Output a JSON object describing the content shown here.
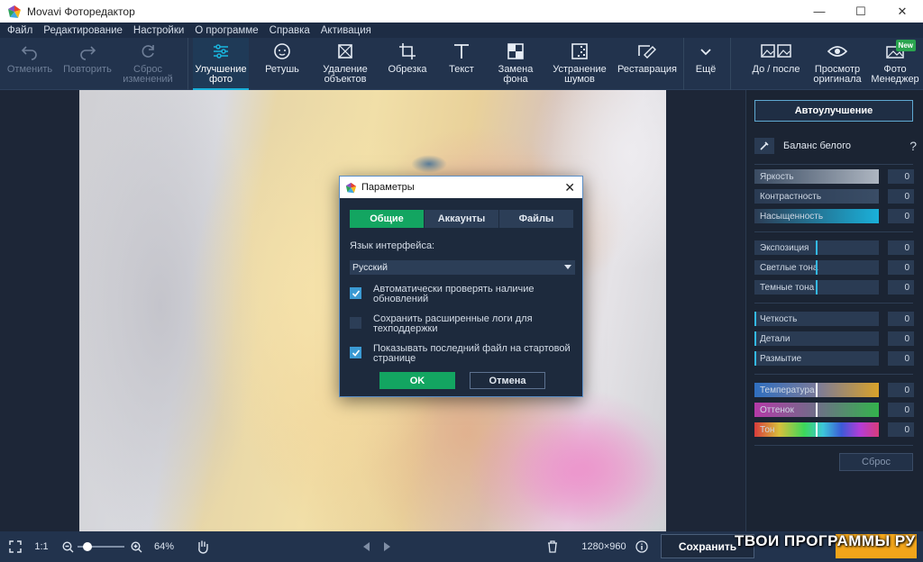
{
  "window": {
    "title": "Movavi Фоторедактор"
  },
  "menu": [
    "Файл",
    "Редактирование",
    "Настройки",
    "О программе",
    "Справка",
    "Активация"
  ],
  "toolbar": {
    "undo": "Отменить",
    "redo": "Повторить",
    "reset_line1": "Сброс",
    "reset_line2": "изменений",
    "enhance_line1": "Улучшение",
    "enhance_line2": "фото",
    "retouch": "Ретушь",
    "remove_line1": "Удаление",
    "remove_line2": "объектов",
    "crop": "Обрезка",
    "text": "Текст",
    "bg_line1": "Замена",
    "bg_line2": "фона",
    "noise_line1": "Устранение",
    "noise_line2": "шумов",
    "restore": "Реставрация",
    "more": "Ещё",
    "before_after": "До / после",
    "original_line1": "Просмотр",
    "original_line2": "оригинала",
    "manager_line1": "Фото",
    "manager_line2": "Менеджер",
    "new_badge": "New"
  },
  "panel": {
    "auto_button": "Автоулучшение",
    "white_balance": "Баланс белого",
    "help": "?",
    "sliders": [
      {
        "label": "Яркость",
        "value": "0"
      },
      {
        "label": "Контрастность",
        "value": "0"
      },
      {
        "label": "Насыщенность",
        "value": "0"
      },
      {
        "label": "Экспозиция",
        "value": "0"
      },
      {
        "label": "Светлые тона",
        "value": "0"
      },
      {
        "label": "Темные тона",
        "value": "0"
      },
      {
        "label": "Четкость",
        "value": "0"
      },
      {
        "label": "Детали",
        "value": "0"
      },
      {
        "label": "Размытие",
        "value": "0"
      },
      {
        "label": "Температура",
        "value": "0"
      },
      {
        "label": "Оттенок",
        "value": "0"
      },
      {
        "label": "Тон",
        "value": "0"
      }
    ],
    "reset_button": "Сброс"
  },
  "status": {
    "ratio": "1:1",
    "zoom": "64%",
    "zoom_level": 0.14,
    "dimensions": "1280×960",
    "save": "Сохранить",
    "watermark": "ТВОИ ПРОГРАММЫ РУ"
  },
  "dialog": {
    "title": "Параметры",
    "tabs": [
      "Общие",
      "Аккаунты",
      "Файлы"
    ],
    "lang_label": "Язык интерфейса:",
    "lang_value": "Русский",
    "options": [
      {
        "label": "Автоматически проверять наличие обновлений",
        "checked": true
      },
      {
        "label": "Сохранить расширенные логи для техподдержки",
        "checked": false
      },
      {
        "label": "Показывать последний файл на стартовой странице",
        "checked": true
      }
    ],
    "ok": "OK",
    "cancel": "Отмена"
  },
  "colors": {
    "accent": "#1ab0d9",
    "ok_green": "#13a561",
    "export_orange": "#f2a51a"
  }
}
